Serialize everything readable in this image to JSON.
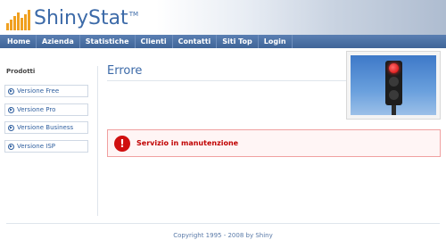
{
  "logo": {
    "text": "ShinyStat",
    "tm": "TM"
  },
  "nav": {
    "items": [
      "Home",
      "Azienda",
      "Statistiche",
      "Clienti",
      "Contatti",
      "Siti Top",
      "Login"
    ]
  },
  "sidebar": {
    "title": "Prodotti",
    "items": [
      {
        "label": "Versione Free"
      },
      {
        "label": "Versione Pro"
      },
      {
        "label": "Versione Business"
      },
      {
        "label": "Versione ISP"
      }
    ]
  },
  "main": {
    "title": "Errore",
    "error_message": "Servizio in manutenzione",
    "error_icon": "!"
  },
  "footer": {
    "text": "Copyright 1995 - 2008 by Shiny"
  },
  "colors": {
    "brand_blue": "#3c6aa8",
    "nav_blue": "#4a70a4",
    "logo_orange": "#f0a020",
    "error_red": "#c00000"
  }
}
